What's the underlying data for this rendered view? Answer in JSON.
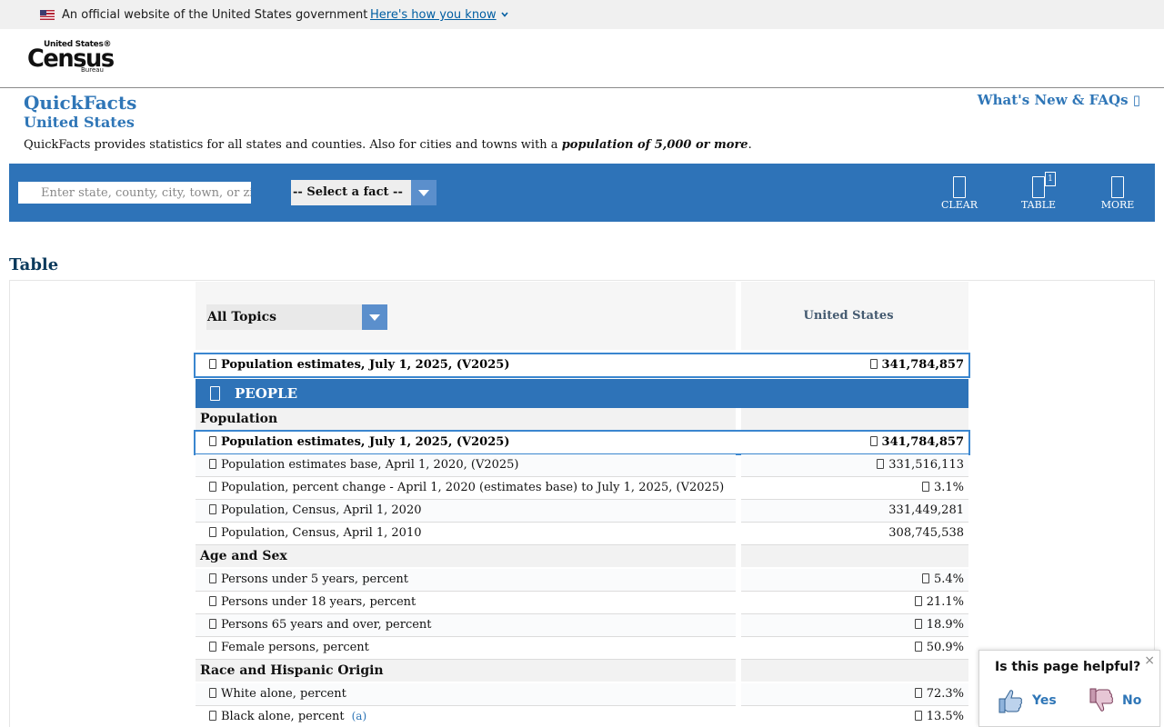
{
  "gov_banner": {
    "text": "An official website of the United States government",
    "link": "Here's how you know"
  },
  "logo": {
    "line1": "United States®",
    "main": "Census",
    "bureau": "Bureau"
  },
  "quickfacts": {
    "title": "QuickFacts",
    "geography": "United States",
    "description_prefix": "QuickFacts provides statistics for all states and counties. Also for cities and towns with a ",
    "description_emphasis": "population of 5,000 or more",
    "description_suffix": ".",
    "whats_new": "What's New & FAQs ▯"
  },
  "search": {
    "placeholder": "Enter state, county, city, town, or zip code",
    "select_label": "-- Select a fact --"
  },
  "tools": {
    "clear": "CLEAR",
    "table": "TABLE",
    "table_badge": "1",
    "more": "MORE"
  },
  "table": {
    "heading": "Table",
    "topic_select": "All Topics",
    "geo_column": "United States",
    "selected_fact": {
      "label": "Population estimates, July 1, 2025, (V2025)",
      "value": "341,784,857"
    },
    "section": "PEOPLE",
    "categories": {
      "population": "Population",
      "age_sex": "Age and Sex",
      "race": "Race and Hispanic Origin"
    },
    "population_rows": [
      {
        "label": "Population estimates base, April 1, 2020, (V2025)",
        "value": "331,516,113",
        "icon": true
      },
      {
        "label": "Population, percent change - April 1, 2020 (estimates base) to July 1, 2025, (V2025)",
        "value": "3.1%",
        "icon": true
      },
      {
        "label": "Population, Census, April 1, 2020",
        "value": "331,449,281",
        "icon": false
      },
      {
        "label": "Population, Census, April 1, 2010",
        "value": "308,745,538",
        "icon": false
      }
    ],
    "age_rows": [
      {
        "label": "Persons under 5 years, percent",
        "value": "5.4%"
      },
      {
        "label": "Persons under 18 years, percent",
        "value": "21.1%"
      },
      {
        "label": "Persons 65 years and over, percent",
        "value": "18.9%"
      },
      {
        "label": "Female persons, percent",
        "value": "50.9%"
      }
    ],
    "race_rows": [
      {
        "label": "White alone, percent",
        "value": "72.3%",
        "note": ""
      },
      {
        "label": "Black alone, percent",
        "value": "13.5%",
        "note": "(a)"
      }
    ]
  },
  "feedback": {
    "question": "Is this page helpful?",
    "yes": "Yes",
    "no": "No",
    "close": "×"
  },
  "colors": {
    "brand_blue": "#2e73b8",
    "link_blue": "#2f76b7",
    "selected_border": "#3a86cf"
  }
}
